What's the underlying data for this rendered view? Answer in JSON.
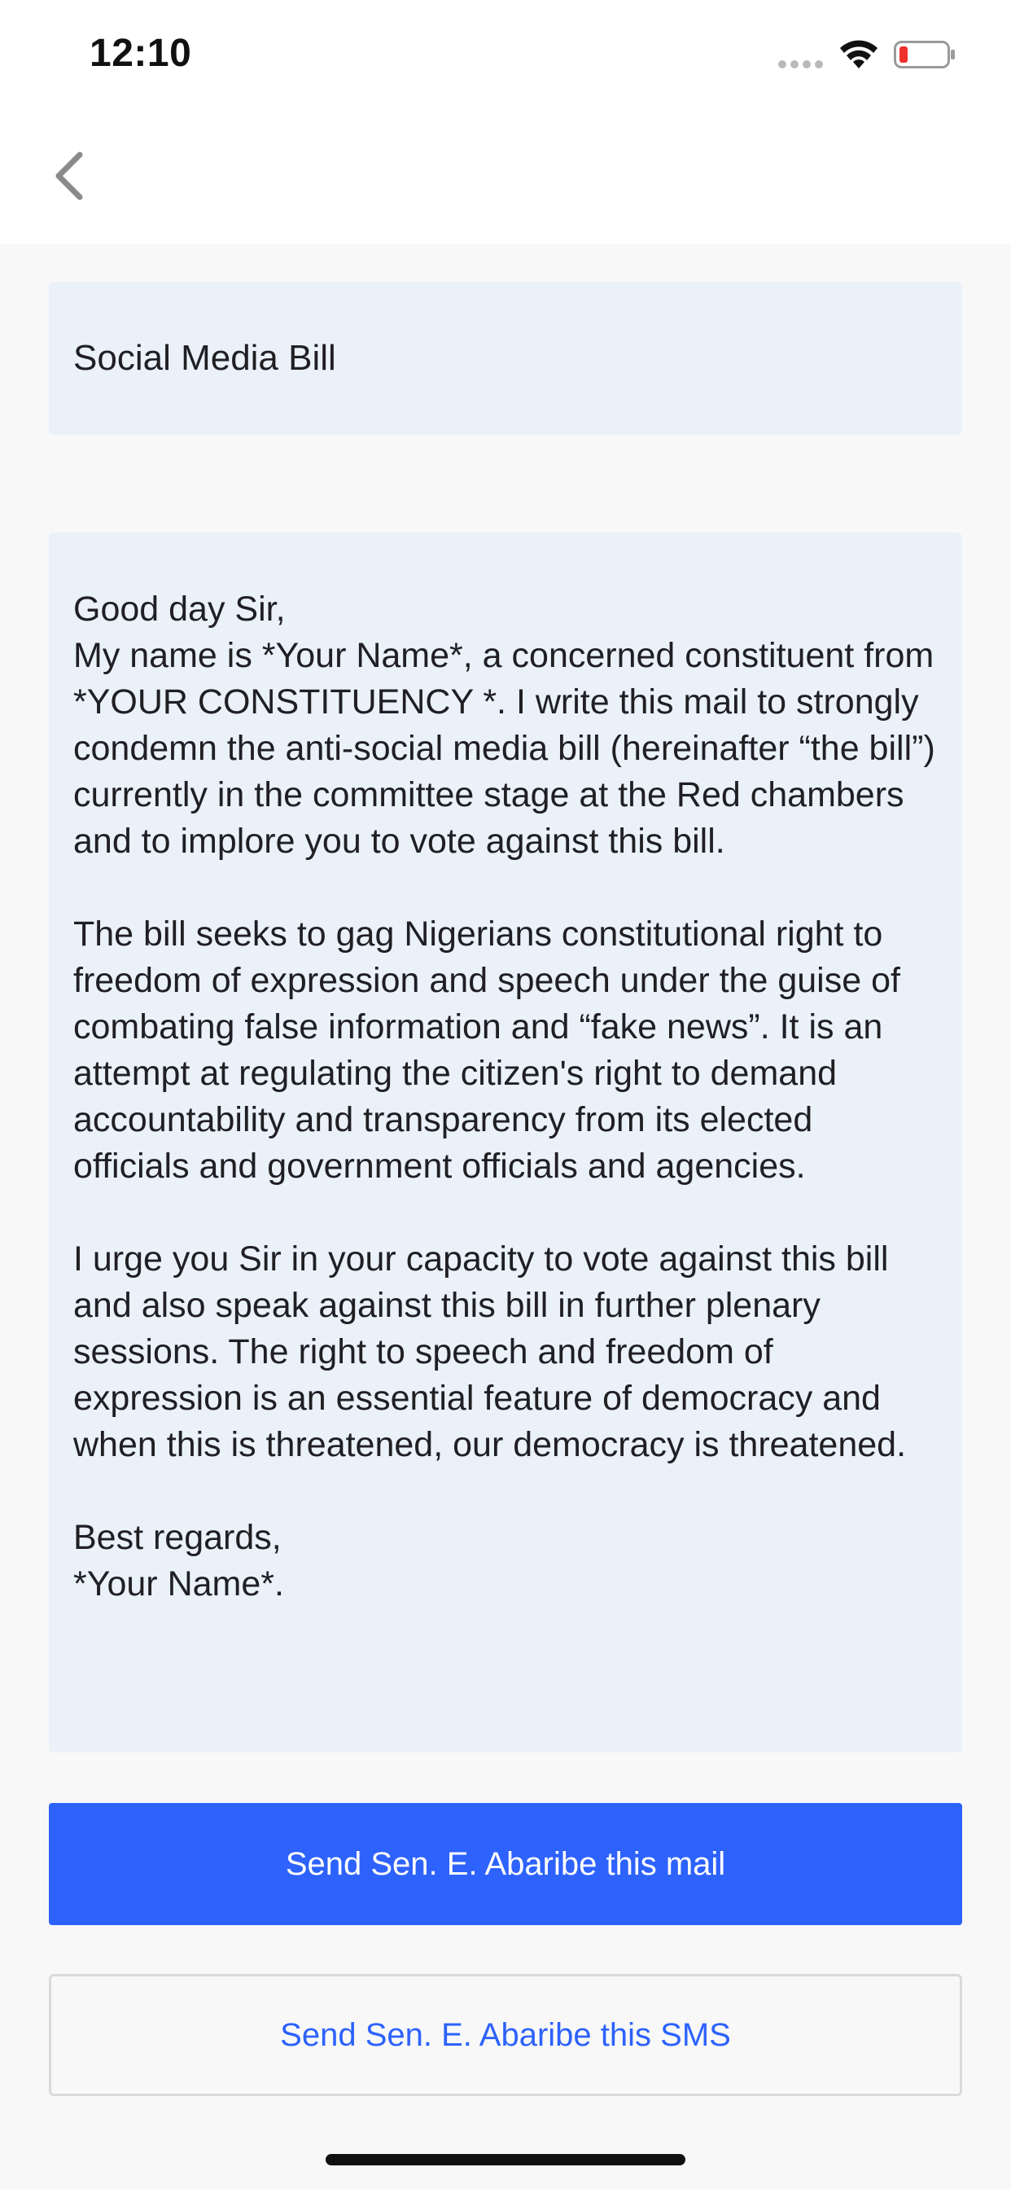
{
  "status_bar": {
    "time": "12:10",
    "icons": [
      "signal-dots-icon",
      "wifi-icon",
      "battery-low-icon"
    ]
  },
  "nav": {
    "back_icon": "chevron-left-icon"
  },
  "subject": "Social Media Bill",
  "message_body": "Good day Sir,\nMy name is *Your Name*, a concerned constituent from *YOUR CONSTITUENCY *. I write this mail to strongly condemn the anti-social media bill (hereinafter “the bill”) currently in the committee stage at the Red chambers and to implore you to vote against this bill.\n\nThe bill seeks to gag Nigerians constitutional right to freedom of expression and speech under the guise of combating false information and “fake news”. It is an attempt at regulating the citizen's right to demand accountability and transparency from its elected officials and government officials and agencies.\n\nI urge you Sir in your capacity to vote against this bill and also speak against this bill in further plenary sessions. The right to speech and freedom of expression is an essential feature of democracy and when this is threatened, our democracy is threatened.\n\nBest regards,\n*Your Name*.",
  "actions": {
    "mail_label": "Send Sen. E. Abaribe this mail",
    "sms_label": "Send Sen. E. Abaribe this SMS"
  },
  "colors": {
    "primary": "#2d62fc",
    "field_background": "#eaf1f9",
    "battery_low": "#f0302c"
  }
}
